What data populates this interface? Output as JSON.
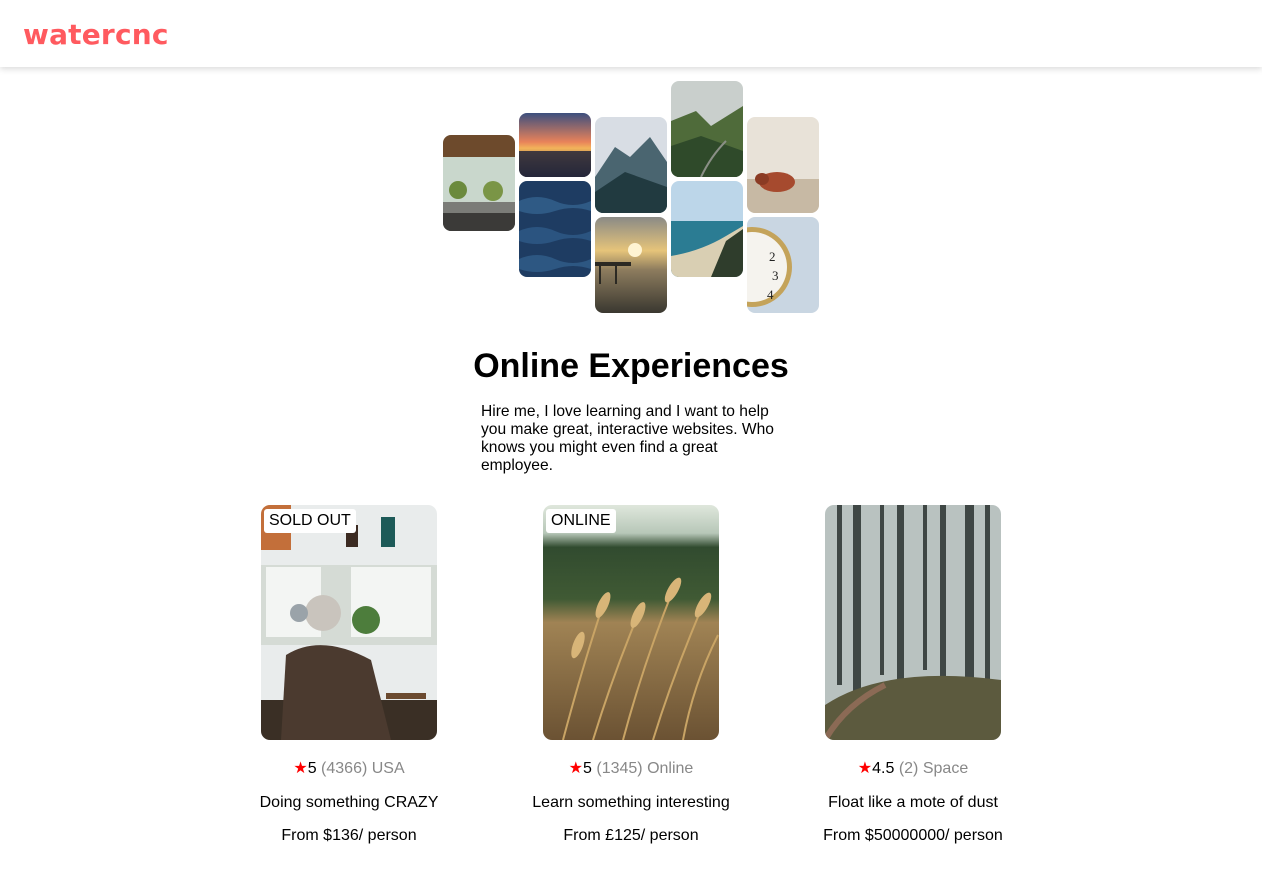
{
  "brand": {
    "logo_text": "watercnc",
    "color": "#FF5A5F"
  },
  "hero": {
    "title": "Online Experiences",
    "text": "Hire me, I love learning and I want to help you make great, interactive websites. Who knows you might even find a great employee."
  },
  "cards": [
    {
      "badge": "SOLD OUT",
      "star": "★",
      "rating": "5",
      "reviews": "(4366)",
      "location": "USA",
      "title": "Doing something CRAZY",
      "price_label": "From $136",
      "per": "/ person"
    },
    {
      "badge": "ONLINE",
      "star": "★",
      "rating": "5",
      "reviews": "(1345)",
      "location": "Online",
      "title": "Learn something interesting",
      "price_label": "From £125",
      "per": "/ person"
    },
    {
      "badge": "",
      "star": "★",
      "rating": "4.5",
      "reviews": "(2)",
      "location": "Space",
      "title": "Float like a mote of dust",
      "price_label": "From $50000000",
      "per": "/ person"
    }
  ]
}
